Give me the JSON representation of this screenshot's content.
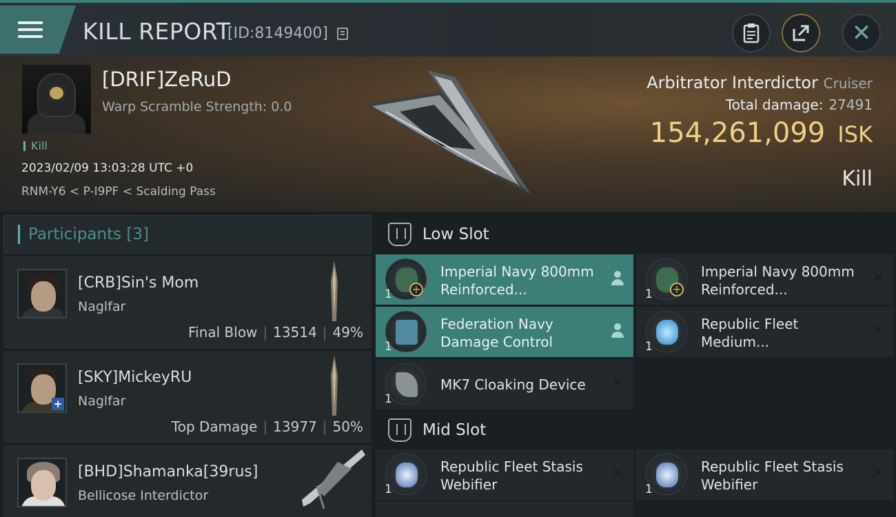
{
  "header": {
    "title": "KILL REPORT",
    "id_text": "[ID:8149400]"
  },
  "victim": {
    "name": "[DRIF]ZeRuD",
    "warp_scramble": "Warp Scramble Strength: 0.0",
    "kill_tag": "Kill",
    "timestamp": "2023/02/09 13:03:28 UTC +0",
    "location": "RNM-Y6 < P-I9PF < Scalding Pass",
    "ship_name": "Arbitrator Interdictor",
    "ship_class": "Cruiser",
    "total_damage_label": "Total damage:",
    "total_damage_value": "27491",
    "isk_value": "154,261,099",
    "isk_unit": "ISK",
    "result": "Kill"
  },
  "participants": {
    "header": "Participants [3]",
    "items": [
      {
        "name": "[CRB]Sin's Mom",
        "ship": "Naglfar",
        "role": "Final Blow",
        "damage": "13514",
        "percent": "49%"
      },
      {
        "name": "[SKY]MickeyRU",
        "ship": "Naglfar",
        "role": "Top Damage",
        "damage": "13977",
        "percent": "50%"
      },
      {
        "name": "[BHD]Shamanka[39rus]",
        "ship": "Bellicose Interdictor",
        "role": "",
        "damage": "",
        "percent": ""
      }
    ]
  },
  "fitting": {
    "low_slot_title": "Low Slot",
    "mid_slot_title": "Mid Slot",
    "low_modules": [
      {
        "qty": "1",
        "name": "Imperial Navy 800mm Reinforced...",
        "highlighted": true
      },
      {
        "qty": "1",
        "name": "Imperial Navy 800mm Reinforced...",
        "highlighted": false
      },
      {
        "qty": "1",
        "name": "Federation Navy Damage Control",
        "highlighted": true
      },
      {
        "qty": "1",
        "name": "Republic Fleet Medium...",
        "highlighted": false
      },
      {
        "qty": "1",
        "name": "MK7 Cloaking Device",
        "highlighted": false
      }
    ],
    "mid_modules": [
      {
        "qty": "1",
        "name": "Republic Fleet Stasis Webifier"
      },
      {
        "qty": "1",
        "name": "Republic Fleet Stasis Webifier"
      }
    ]
  },
  "colors": {
    "accent_teal": "#3c7e78",
    "isk_gold": "#f1cf86"
  }
}
